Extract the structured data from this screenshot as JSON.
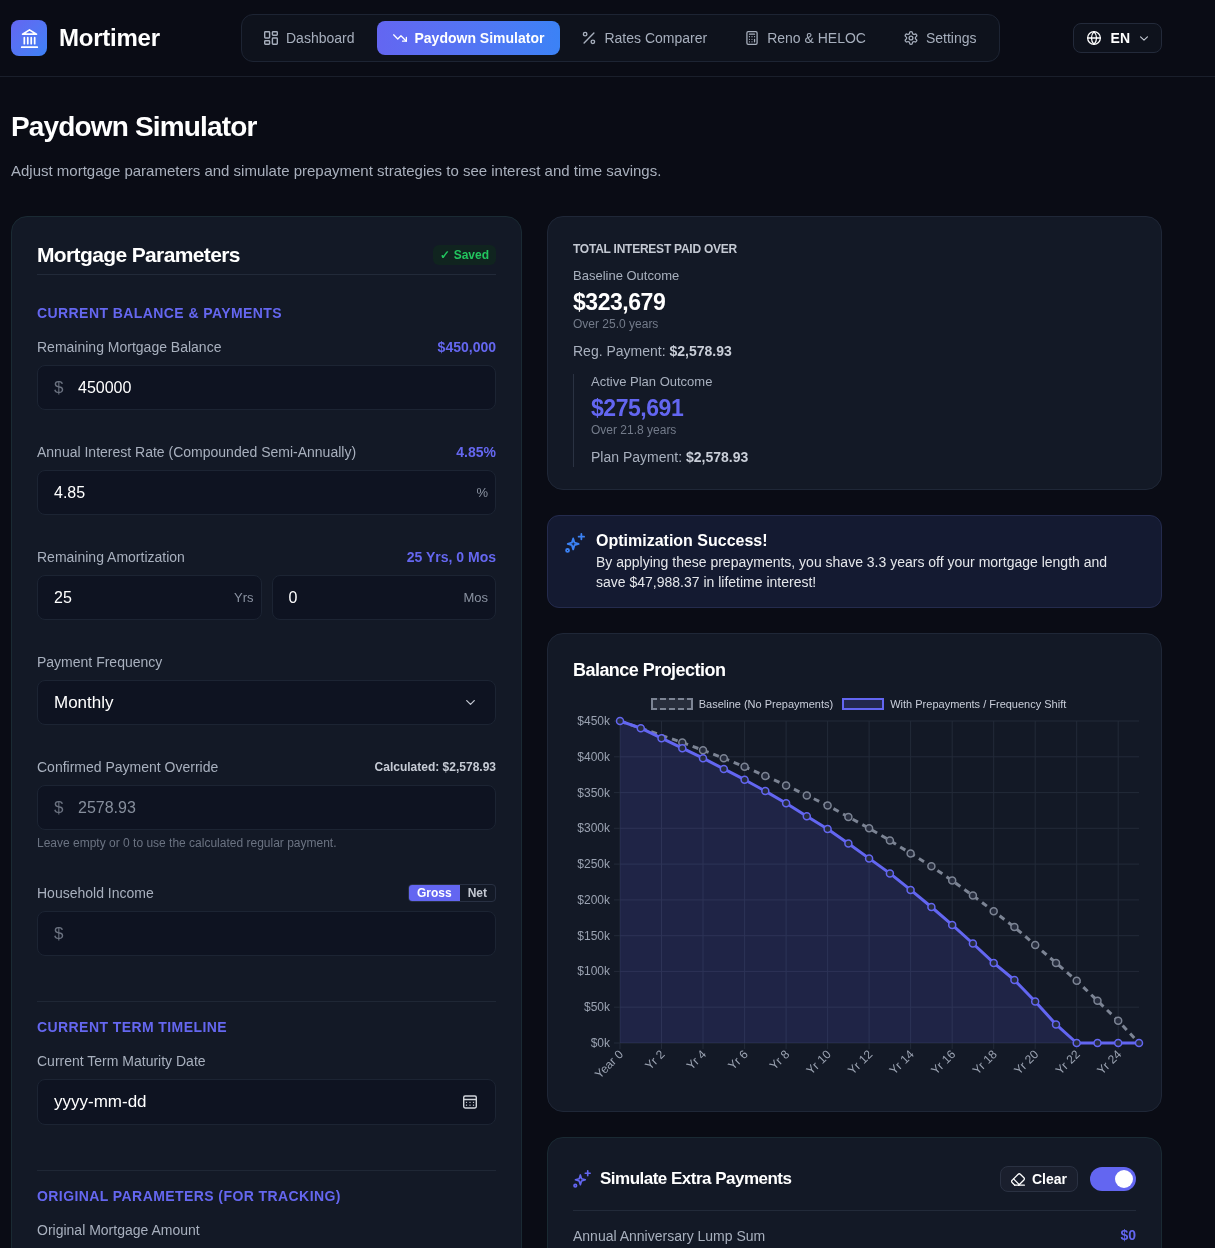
{
  "header": {
    "brand": "Mortimer",
    "nav": [
      {
        "label": "Dashboard",
        "selected": false
      },
      {
        "label": "Paydown Simulator",
        "selected": true
      },
      {
        "label": "Rates Comparer",
        "selected": false
      },
      {
        "label": "Reno & HELOC",
        "selected": false
      },
      {
        "label": "Settings",
        "selected": false
      }
    ],
    "language": "EN"
  },
  "page": {
    "title": "Paydown Simulator",
    "subtitle": "Adjust mortgage parameters and simulate prepayment strategies to see interest and time savings."
  },
  "parameters": {
    "title": "Mortgage Parameters",
    "status": "✓ Saved",
    "sections": [
      {
        "title": "CURRENT BALANCE & PAYMENTS",
        "fields": [
          {
            "kind": "input",
            "label": "Remaining Mortgage Balance",
            "badge": "$450,000",
            "prefix": "$",
            "value": "450000"
          },
          {
            "kind": "input",
            "label": "Annual Interest Rate (Compounded Semi-Annually)",
            "badge": "4.85%",
            "value": "4.85",
            "suffix": "%"
          },
          {
            "kind": "split",
            "label": "Remaining Amortization",
            "badge": "25 Yrs, 0 Mos",
            "inputs": [
              {
                "value": "25",
                "suffix": "Yrs"
              },
              {
                "value": "0",
                "suffix": "Mos"
              }
            ]
          },
          {
            "kind": "select",
            "label": "Payment Frequency",
            "value": "Monthly"
          },
          {
            "kind": "input",
            "label": "Confirmed Payment Override",
            "note": "Calculated: $2,578.93",
            "prefix": "$",
            "placeholder": "2578.93",
            "help": "Leave empty or 0 to use the calculated regular payment."
          },
          {
            "kind": "input",
            "label": "Household Income",
            "options": [
              {
                "label": "Gross",
                "selected": true
              },
              {
                "label": "Net",
                "selected": false
              }
            ],
            "prefix": "$"
          }
        ]
      },
      {
        "title": "CURRENT TERM TIMELINE",
        "fields": [
          {
            "kind": "date",
            "label": "Current Term Maturity Date",
            "placeholder": "yyyy-mm-dd"
          }
        ]
      },
      {
        "title": "ORIGINAL PARAMETERS (FOR TRACKING)",
        "fields": [
          {
            "kind": "input",
            "label": "Original Mortgage Amount"
          }
        ]
      }
    ]
  },
  "summary": {
    "heading": "TOTAL INTEREST PAID OVER",
    "baseline": {
      "label": "Baseline Outcome",
      "amount": "$323,679",
      "duration": "Over 25.0 years",
      "payment": "Reg. Payment: **$2,578.93**"
    },
    "plan": {
      "label": "Active Plan Outcome",
      "amount": "$275,691",
      "duration": "Over 21.8 years",
      "payment": "Plan Payment: **$2,578.93**"
    }
  },
  "success": {
    "title": "Optimization Success!",
    "message": "By applying these prepayments, you shave 3.3 years off your mortgage length and save $47,988.37 in lifetime interest!"
  },
  "chart": {
    "chart_data": {
      "type": "line",
      "title": "Balance Projection",
      "grid": true,
      "legend": "top",
      "categories": [
        "Year 0",
        null,
        "Yr 2",
        null,
        "Yr 4",
        null,
        "Yr 6",
        null,
        "Yr 8",
        null,
        "Yr 10",
        null,
        "Yr 12",
        null,
        "Yr 14",
        null,
        "Yr 16",
        null,
        "Yr 18",
        null,
        "Yr 20",
        null,
        "Yr 22",
        null,
        "Yr 24",
        null
      ],
      "ylim": [
        0,
        450000
      ],
      "yticks": [
        {
          "value": 0,
          "label": "$0k"
        },
        {
          "value": 50000,
          "label": "$50k"
        },
        {
          "value": 100000,
          "label": "$100k"
        },
        {
          "value": 150000,
          "label": "$150k"
        },
        {
          "value": 200000,
          "label": "$200k"
        },
        {
          "value": 250000,
          "label": "$250k"
        },
        {
          "value": 300000,
          "label": "$300k"
        },
        {
          "value": 350000,
          "label": "$350k"
        },
        {
          "value": 400000,
          "label": "$400k"
        },
        {
          "value": 450000,
          "label": "$450k"
        }
      ],
      "series": [
        {
          "name": "Baseline (No Prepayments)",
          "color": "#7c8494",
          "line_style": "dashed",
          "marker": "circle",
          "values": [
            450000,
            440000,
            430000,
            420000,
            409000,
            398000,
            386000,
            373000,
            360000,
            346000,
            332000,
            316000,
            300000,
            283000,
            265000,
            247000,
            227000,
            206000,
            184000,
            162000,
            137000,
            112000,
            87000,
            59000,
            31000,
            0
          ]
        },
        {
          "name": "With Prepayments / Frequency Shift",
          "color": "#6366f1",
          "line_style": "solid",
          "marker": "circle",
          "values": [
            450000,
            440000,
            426000,
            412000,
            398000,
            383000,
            368000,
            352000,
            335000,
            317000,
            299000,
            279000,
            258000,
            237000,
            214000,
            190000,
            165000,
            139000,
            112000,
            88000,
            58000,
            26000,
            0,
            0,
            0,
            0
          ]
        }
      ]
    }
  },
  "extra": {
    "title": "Simulate Extra Payments",
    "clear": "Clear",
    "on": true,
    "fields": [
      {
        "label": "Annual Anniversary Lump Sum",
        "amount": "$0"
      }
    ]
  }
}
